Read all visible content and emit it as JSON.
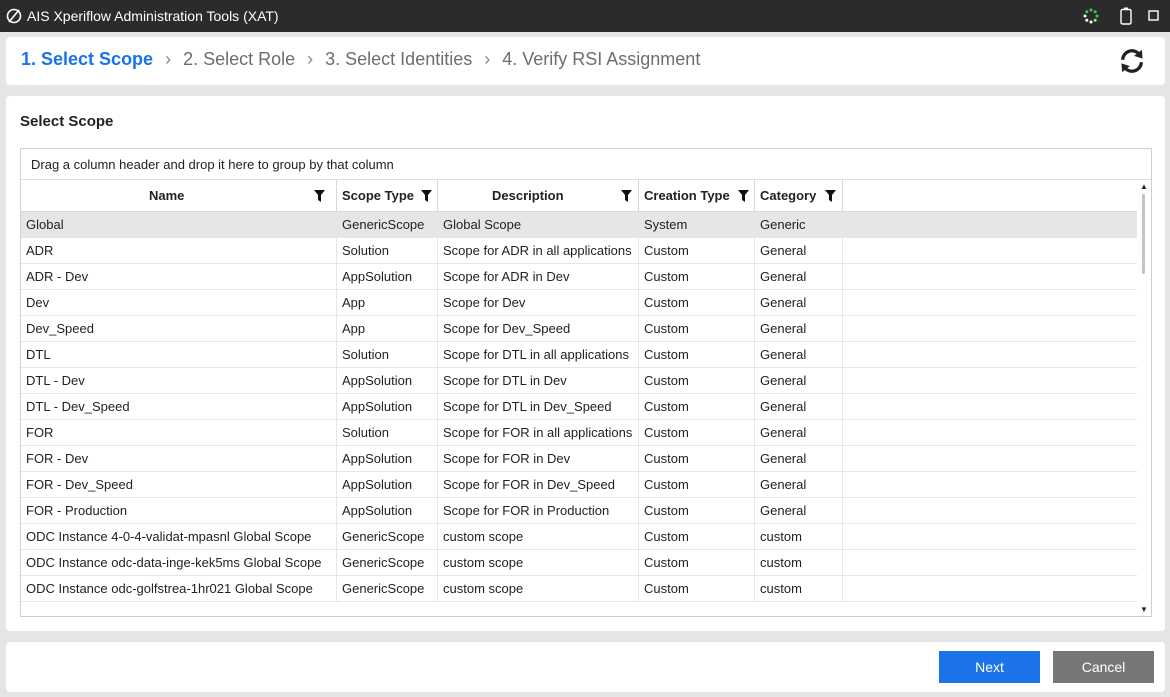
{
  "window": {
    "title": "AIS Xperiflow Administration Tools (XAT)"
  },
  "steps": [
    {
      "label": "1. Select Scope",
      "active": true
    },
    {
      "label": "2. Select Role",
      "active": false
    },
    {
      "label": "3. Select Identities",
      "active": false
    },
    {
      "label": "4. Verify RSI Assignment",
      "active": false
    }
  ],
  "section": {
    "title": "Select Scope"
  },
  "grid": {
    "group_hint": "Drag a column header and drop it here to group by that column",
    "columns": [
      "Name",
      "Scope Type",
      "Description",
      "Creation Type",
      "Category"
    ],
    "rows": [
      {
        "name": "Global",
        "type": "GenericScope",
        "desc": "Global Scope",
        "ctype": "System",
        "cat": "Generic",
        "selected": true
      },
      {
        "name": "ADR",
        "type": "Solution",
        "desc": "Scope for ADR in all applications",
        "ctype": "Custom",
        "cat": "General"
      },
      {
        "name": "ADR - Dev",
        "type": "AppSolution",
        "desc": "Scope for ADR in Dev",
        "ctype": "Custom",
        "cat": "General"
      },
      {
        "name": "Dev",
        "type": "App",
        "desc": "Scope for Dev",
        "ctype": "Custom",
        "cat": "General"
      },
      {
        "name": "Dev_Speed",
        "type": "App",
        "desc": "Scope for Dev_Speed",
        "ctype": "Custom",
        "cat": "General"
      },
      {
        "name": "DTL",
        "type": "Solution",
        "desc": "Scope for DTL in all applications",
        "ctype": "Custom",
        "cat": "General"
      },
      {
        "name": "DTL - Dev",
        "type": "AppSolution",
        "desc": "Scope for DTL in Dev",
        "ctype": "Custom",
        "cat": "General"
      },
      {
        "name": "DTL - Dev_Speed",
        "type": "AppSolution",
        "desc": "Scope for DTL in Dev_Speed",
        "ctype": "Custom",
        "cat": "General"
      },
      {
        "name": "FOR",
        "type": "Solution",
        "desc": "Scope for FOR in all applications",
        "ctype": "Custom",
        "cat": "General"
      },
      {
        "name": "FOR - Dev",
        "type": "AppSolution",
        "desc": "Scope for FOR in Dev",
        "ctype": "Custom",
        "cat": "General"
      },
      {
        "name": "FOR - Dev_Speed",
        "type": "AppSolution",
        "desc": "Scope for FOR in Dev_Speed",
        "ctype": "Custom",
        "cat": "General"
      },
      {
        "name": "FOR - Production",
        "type": "AppSolution",
        "desc": "Scope for FOR in Production",
        "ctype": "Custom",
        "cat": "General"
      },
      {
        "name": "ODC Instance 4-0-4-validat-mpasnl Global Scope",
        "type": "GenericScope",
        "desc": "custom scope",
        "ctype": "Custom",
        "cat": "custom"
      },
      {
        "name": "ODC Instance odc-data-inge-kek5ms Global Scope",
        "type": "GenericScope",
        "desc": "custom scope",
        "ctype": "Custom",
        "cat": "custom"
      },
      {
        "name": "ODC Instance odc-golfstrea-1hr021 Global Scope",
        "type": "GenericScope",
        "desc": "custom scope",
        "ctype": "Custom",
        "cat": "custom"
      }
    ]
  },
  "buttons": {
    "next": "Next",
    "cancel": "Cancel"
  },
  "colors": {
    "accent": "#1a73e8",
    "titlebar": "#2b2b2b",
    "cancel": "#777777"
  }
}
